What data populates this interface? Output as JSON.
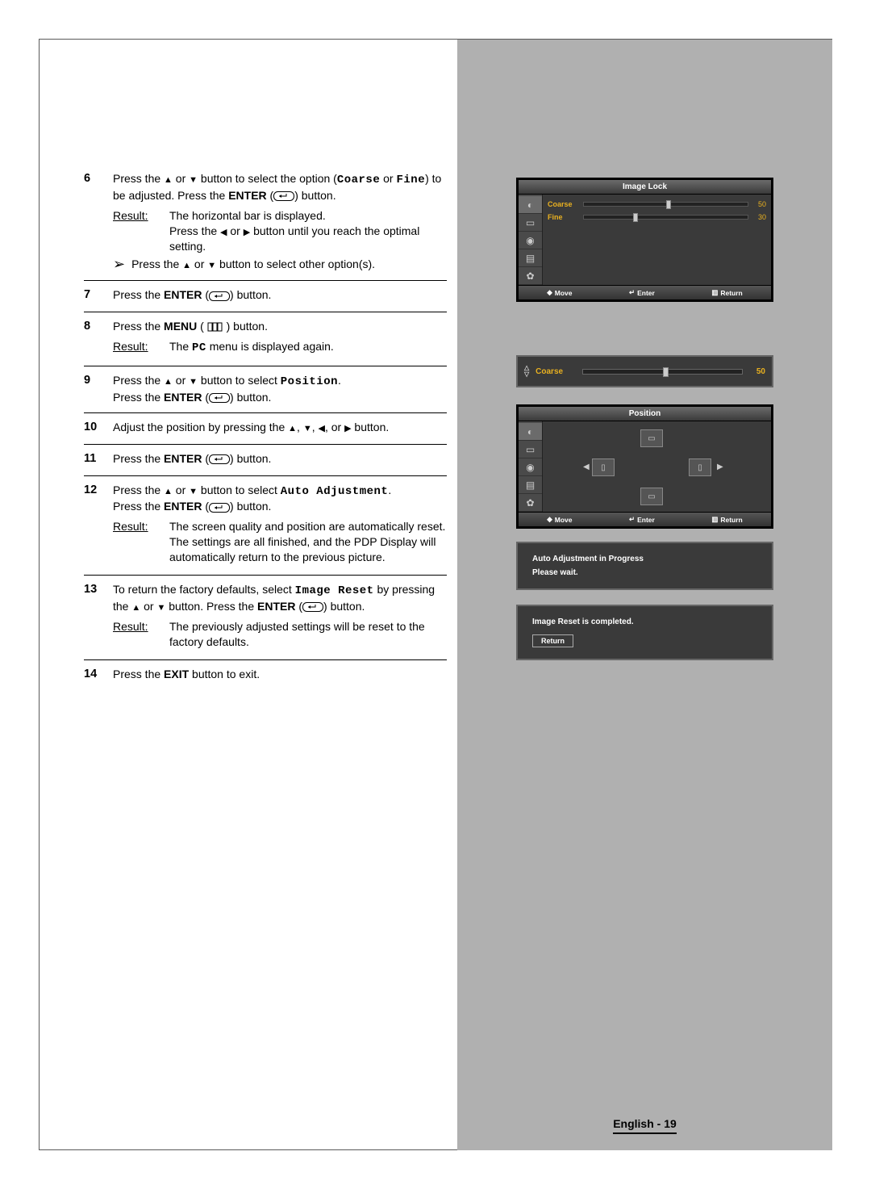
{
  "steps": [
    {
      "num": "6",
      "lines": [
        {
          "t": "p",
          "parts": [
            {
              "txt": "Press the "
            },
            {
              "tri": "▲"
            },
            {
              "txt": " or "
            },
            {
              "tri": "▼"
            },
            {
              "txt": " button to select the option ("
            },
            {
              "mono": "Coarse"
            },
            {
              "txt": " or "
            },
            {
              "mono": "Fine"
            },
            {
              "txt": ") to be adjusted. Press the "
            },
            {
              "bold": "ENTER"
            },
            {
              "txt": " ("
            },
            {
              "icon": "enter"
            },
            {
              "txt": ") button."
            }
          ]
        },
        {
          "t": "result",
          "label": "Result:",
          "text": [
            {
              "txt": "The horizontal bar is displayed."
            },
            {
              "br": true
            },
            {
              "txt": "Press the "
            },
            {
              "tri": "◀"
            },
            {
              "txt": " or "
            },
            {
              "tri": "▶"
            },
            {
              "txt": " button until you reach the optimal setting."
            }
          ]
        },
        {
          "t": "arrow",
          "text": [
            {
              "txt": "Press the "
            },
            {
              "tri": "▲"
            },
            {
              "txt": " or "
            },
            {
              "tri": "▼"
            },
            {
              "txt": " button to select other option(s)."
            }
          ]
        }
      ]
    },
    {
      "num": "7",
      "lines": [
        {
          "t": "p",
          "parts": [
            {
              "txt": "Press the "
            },
            {
              "bold": "ENTER"
            },
            {
              "txt": " ("
            },
            {
              "icon": "enter"
            },
            {
              "txt": ") button."
            }
          ]
        }
      ]
    },
    {
      "num": "8",
      "lines": [
        {
          "t": "p",
          "parts": [
            {
              "txt": "Press the "
            },
            {
              "bold": "MENU"
            },
            {
              "txt": " ( "
            },
            {
              "icon": "menu"
            },
            {
              "txt": " ) button."
            }
          ]
        },
        {
          "t": "result",
          "label": "Result:",
          "text": [
            {
              "txt": "The "
            },
            {
              "mono": "PC"
            },
            {
              "txt": " menu is displayed again."
            }
          ]
        }
      ]
    },
    {
      "num": "9",
      "lines": [
        {
          "t": "p",
          "parts": [
            {
              "txt": "Press the "
            },
            {
              "tri": "▲"
            },
            {
              "txt": " or "
            },
            {
              "tri": "▼"
            },
            {
              "txt": " button to select "
            },
            {
              "mono": "Position"
            },
            {
              "txt": "."
            },
            {
              "br": true
            },
            {
              "txt": "Press the "
            },
            {
              "bold": "ENTER"
            },
            {
              "txt": " ("
            },
            {
              "icon": "enter"
            },
            {
              "txt": ") button."
            }
          ]
        }
      ]
    },
    {
      "num": "10",
      "lines": [
        {
          "t": "p",
          "parts": [
            {
              "txt": "Adjust the position by pressing the "
            },
            {
              "tri": "▲"
            },
            {
              "txt": ", "
            },
            {
              "tri": "▼"
            },
            {
              "txt": ", "
            },
            {
              "tri": "◀"
            },
            {
              "txt": ", or "
            },
            {
              "tri": "▶"
            },
            {
              "txt": " button."
            }
          ]
        }
      ]
    },
    {
      "num": "11",
      "lines": [
        {
          "t": "p",
          "parts": [
            {
              "txt": "Press the "
            },
            {
              "bold": "ENTER"
            },
            {
              "txt": " ("
            },
            {
              "icon": "enter"
            },
            {
              "txt": ") button."
            }
          ]
        }
      ]
    },
    {
      "num": "12",
      "lines": [
        {
          "t": "p",
          "parts": [
            {
              "txt": "Press the "
            },
            {
              "tri": "▲"
            },
            {
              "txt": " or "
            },
            {
              "tri": "▼"
            },
            {
              "txt": " button to select "
            },
            {
              "mono": "Auto Adjustment"
            },
            {
              "txt": "."
            },
            {
              "br": true
            },
            {
              "txt": "Press the "
            },
            {
              "bold": "ENTER"
            },
            {
              "txt": " ("
            },
            {
              "icon": "enter"
            },
            {
              "txt": ") button."
            }
          ]
        },
        {
          "t": "result",
          "label": "Result:",
          "text": [
            {
              "txt": "The screen quality and position are automatically reset. The settings are all finished, and the PDP Display will automatically return to the previous picture."
            }
          ]
        }
      ]
    },
    {
      "num": "13",
      "lines": [
        {
          "t": "p",
          "parts": [
            {
              "txt": "To return the factory defaults, select "
            },
            {
              "mono": "Image Reset"
            },
            {
              "txt": " by pressing the "
            },
            {
              "tri": "▲"
            },
            {
              "txt": " or "
            },
            {
              "tri": "▼"
            },
            {
              "txt": " button. Press the "
            },
            {
              "bold": "ENTER"
            },
            {
              "txt": " ("
            },
            {
              "icon": "enter"
            },
            {
              "txt": ") button."
            }
          ]
        },
        {
          "t": "result",
          "label": "Result:",
          "text": [
            {
              "txt": "The previously adjusted settings will be reset to the factory defaults."
            }
          ]
        }
      ]
    },
    {
      "num": "14",
      "lines": [
        {
          "t": "p",
          "parts": [
            {
              "txt": "Press the "
            },
            {
              "bold": "EXIT"
            },
            {
              "txt": " button to exit."
            }
          ]
        }
      ]
    }
  ],
  "osd1": {
    "title": "Image Lock",
    "rows": [
      {
        "label": "Coarse",
        "val": "50",
        "pos": 50
      },
      {
        "label": "Fine",
        "val": "30",
        "pos": 30
      }
    ],
    "footer": {
      "move": "Move",
      "enter": "Enter",
      "return": "Return"
    }
  },
  "slider": {
    "label": "Coarse",
    "val": "50",
    "pos": 50
  },
  "osd2": {
    "title": "Position",
    "footer": {
      "move": "Move",
      "enter": "Enter",
      "return": "Return"
    }
  },
  "msg1": {
    "line1": "Auto Adjustment in Progress",
    "line2": "Please wait."
  },
  "msg2": {
    "line1": "Image Reset is completed.",
    "return": "Return"
  },
  "footer": "English - 19"
}
